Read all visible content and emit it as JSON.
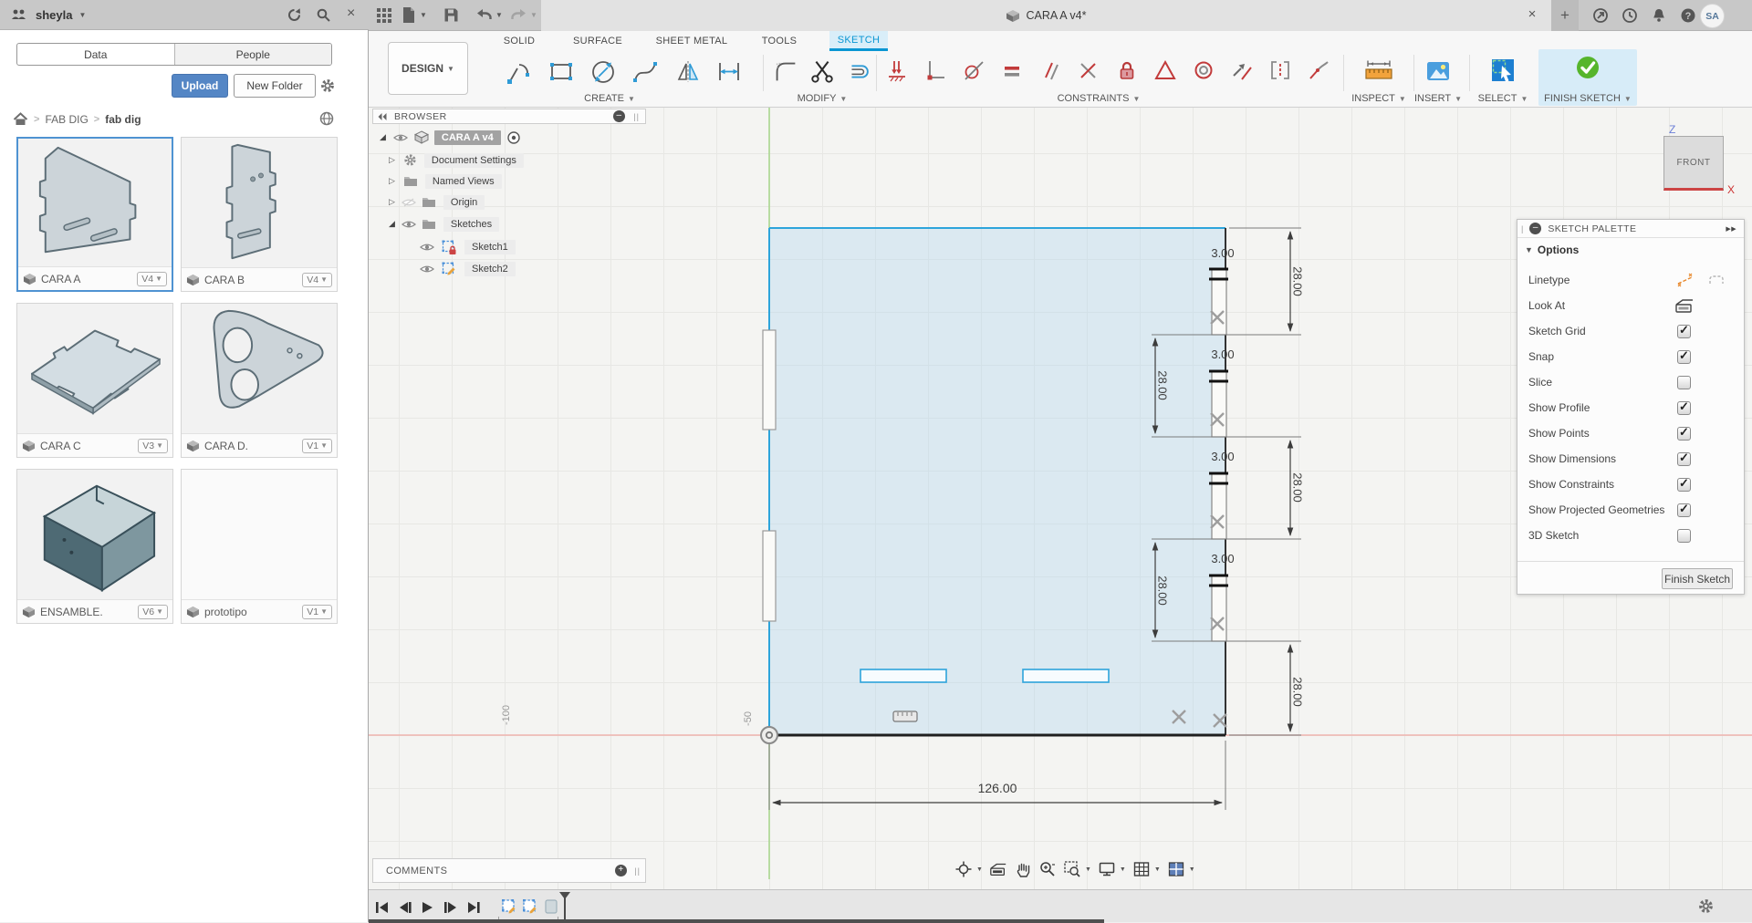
{
  "colors": {
    "accent": "#0a96d3",
    "constraint_red": "#c23b3b",
    "finish_green": "#56b52c",
    "select_blue": "#1d7fd1",
    "inspect_orange": "#f2a33c",
    "axis_red": "#efb3ae",
    "axis_green": "#a5d58a",
    "sketch_blue": "#2da4db",
    "upload_blue": "#5486c5"
  },
  "data_panel": {
    "user": "sheyla",
    "tab_data": "Data",
    "tab_people": "People",
    "upload": "Upload",
    "new_folder": "New Folder",
    "breadcrumb_root": "FAB DIG",
    "breadcrumb_current": "fab dig",
    "cards": [
      {
        "name": "CARA A",
        "version": "V4"
      },
      {
        "name": "CARA B",
        "version": "V4"
      },
      {
        "name": "CARA C",
        "version": "V3"
      },
      {
        "name": "CARA D.",
        "version": "V1"
      },
      {
        "name": "ENSAMBLE.",
        "version": "V6"
      },
      {
        "name": "prototipo",
        "version": "V1"
      }
    ]
  },
  "titlebar": {
    "document_tab": "CARA A v4*",
    "avatar": "SA",
    "left_icons": [
      "app-grid",
      "file",
      "save",
      "undo",
      "redo"
    ],
    "right_icons": [
      "close-tab",
      "new-tab",
      "extensions",
      "job-status",
      "notifications",
      "help"
    ]
  },
  "ribbon": {
    "workspace": "DESIGN",
    "tabs": [
      {
        "label": "SOLID"
      },
      {
        "label": "SURFACE"
      },
      {
        "label": "SHEET METAL"
      },
      {
        "label": "TOOLS"
      },
      {
        "label": "SKETCH",
        "active": true
      }
    ],
    "groups": {
      "create": "CREATE",
      "modify": "MODIFY",
      "constraints": "CONSTRAINTS",
      "inspect": "INSPECT",
      "insert": "INSERT",
      "select": "SELECT",
      "finish": "FINISH SKETCH"
    },
    "icon_names": {
      "create": [
        "line",
        "rectangle",
        "circle",
        "spline",
        "mirror",
        "dimension"
      ],
      "modify": [
        "fillet",
        "trim",
        "offset"
      ],
      "constraints": [
        "horizontal-vertical",
        "perpendicular",
        "tangent",
        "equal",
        "parallel",
        "coincident",
        "fix",
        "polygon",
        "concentric",
        "symmetry",
        "curvature",
        "smooth"
      ]
    }
  },
  "browser": {
    "title": "BROWSER",
    "root": "CARA A v4",
    "items": [
      "Document Settings",
      "Named Views",
      "Origin",
      "Sketches"
    ],
    "sketches": [
      "Sketch1",
      "Sketch2"
    ]
  },
  "palette": {
    "title": "SKETCH PALETTE",
    "section": "Options",
    "rows": [
      {
        "label": "Linetype"
      },
      {
        "label": "Look At"
      },
      {
        "label": "Sketch Grid",
        "checked": true
      },
      {
        "label": "Snap",
        "checked": true
      },
      {
        "label": "Slice",
        "checked": false
      },
      {
        "label": "Show Profile",
        "checked": true
      },
      {
        "label": "Show Points",
        "checked": true
      },
      {
        "label": "Show Dimensions",
        "checked": true
      },
      {
        "label": "Show Constraints",
        "checked": true
      },
      {
        "label": "Show Projected Geometries",
        "checked": true
      },
      {
        "label": "3D Sketch",
        "checked": false
      }
    ],
    "finish_button": "Finish Sketch"
  },
  "canvas": {
    "dims_3": [
      "3.00",
      "3.00",
      "3.00",
      "3.00"
    ],
    "dims_28_right": [
      "28.00",
      "28.00",
      "28.00"
    ],
    "dims_28_left": [
      "28.00",
      "28.00"
    ],
    "dim_width": "126.00",
    "grid_labels": [
      "-100",
      "-50"
    ],
    "viewcube": {
      "face": "FRONT",
      "axis_z": "Z",
      "axis_x": "X"
    }
  },
  "comments": {
    "title": "COMMENTS"
  }
}
